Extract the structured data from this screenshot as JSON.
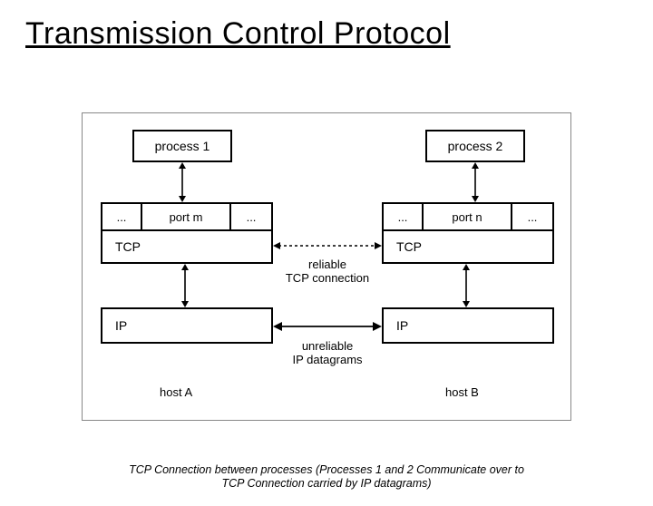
{
  "title": "Transmission Control Protocol",
  "caption_line1": "TCP Connection between processes (Processes 1 and 2 Communicate over to",
  "caption_line2": "TCP Connection carried by IP datagrams)",
  "hostA": {
    "process": "process 1",
    "port_cells": {
      "left": "...",
      "mid": "port m",
      "right": "..."
    },
    "tcp": "TCP",
    "ip": "IP",
    "host_label": "host A"
  },
  "hostB": {
    "process": "process 2",
    "port_cells": {
      "left": "...",
      "mid": "port n",
      "right": "..."
    },
    "tcp": "TCP",
    "ip": "IP",
    "host_label": "host B"
  },
  "conn_labels": {
    "tcp": "reliable\nTCP connection",
    "ip": "unreliable\nIP datagrams"
  }
}
